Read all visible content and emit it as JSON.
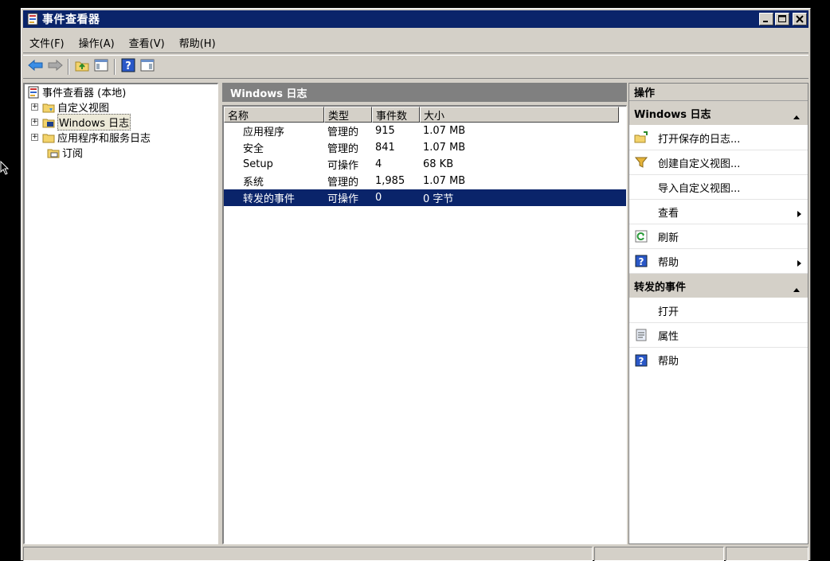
{
  "window": {
    "title": "事件查看器"
  },
  "menu": [
    "文件(F)",
    "操作(A)",
    "查看(V)",
    "帮助(H)"
  ],
  "toolbar": {
    "buttons": [
      "back-icon",
      "forward-icon",
      "folder-up-icon",
      "show-hide-console-tree-icon",
      "help-icon",
      "show-hide-action-pane-icon"
    ]
  },
  "tree": {
    "root": "事件查看器 (本地)",
    "items": [
      {
        "label": "自定义视图",
        "expandable": true
      },
      {
        "label": "Windows 日志",
        "expandable": true,
        "selected": true
      },
      {
        "label": "应用程序和服务日志",
        "expandable": true
      },
      {
        "label": "订阅",
        "expandable": false
      }
    ]
  },
  "center": {
    "header": "Windows 日志",
    "columns": [
      "名称",
      "类型",
      "事件数",
      "大小"
    ],
    "rows": [
      {
        "name": "应用程序",
        "type": "管理的",
        "count": "915",
        "size": "1.07 MB"
      },
      {
        "name": "安全",
        "type": "管理的",
        "count": "841",
        "size": "1.07 MB"
      },
      {
        "name": "Setup",
        "type": "可操作",
        "count": "4",
        "size": "68 KB"
      },
      {
        "name": "系统",
        "type": "管理的",
        "count": "1,985",
        "size": "1.07 MB"
      },
      {
        "name": "转发的事件",
        "type": "可操作",
        "count": "0",
        "size": "0 字节",
        "selected": true
      }
    ]
  },
  "actions": {
    "title": "操作",
    "section1": {
      "title": "Windows 日志",
      "items": [
        {
          "label": "打开保存的日志...",
          "icon": "open-folder-icon"
        },
        {
          "label": "创建自定义视图...",
          "icon": "filter-icon"
        },
        {
          "label": "导入自定义视图...",
          "icon": ""
        },
        {
          "label": "查看",
          "icon": "",
          "submenu": true
        },
        {
          "label": "刷新",
          "icon": "refresh-icon"
        },
        {
          "label": "帮助",
          "icon": "help-icon",
          "submenu": true
        }
      ]
    },
    "section2": {
      "title": "转发的事件",
      "items": [
        {
          "label": "打开",
          "icon": ""
        },
        {
          "label": "属性",
          "icon": "properties-icon"
        },
        {
          "label": "帮助",
          "icon": "help-icon"
        }
      ]
    }
  },
  "colors": {
    "titlebar": "#0a246a",
    "face": "#d4d0c8",
    "selection": "#0a246a",
    "pane_header": "#808080"
  }
}
